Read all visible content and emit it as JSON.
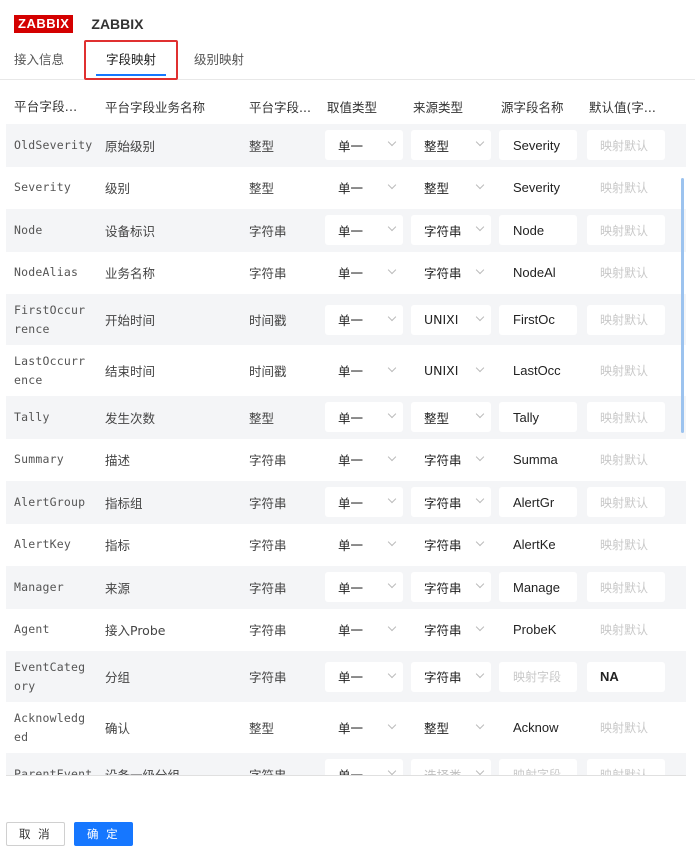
{
  "header": {
    "logo_text": "ZABBIX",
    "title": "ZABBIX"
  },
  "tabs": [
    {
      "label": "接入信息",
      "active": false
    },
    {
      "label": "字段映射",
      "active": true
    },
    {
      "label": "级别映射",
      "active": false
    }
  ],
  "table": {
    "columns": [
      "平台字段...",
      "平台字段业务名称",
      "平台字段...",
      "取值类型",
      "来源类型",
      "源字段名称",
      "默认值(字..."
    ],
    "rows": [
      {
        "field": "OldSeverity",
        "biz_name": "原始级别",
        "type": "整型",
        "value_type": "单一",
        "source_type": "整型",
        "source_field": "Severity",
        "source_field_placeholder": false,
        "default": "映射默认",
        "default_placeholder": true
      },
      {
        "field": "Severity",
        "biz_name": "级别",
        "type": "整型",
        "value_type": "单一",
        "source_type": "整型",
        "source_field": "Severity",
        "source_field_placeholder": false,
        "default": "映射默认",
        "default_placeholder": true
      },
      {
        "field": "Node",
        "biz_name": "设备标识",
        "type": "字符串",
        "value_type": "单一",
        "source_type": "字符串",
        "source_field": "Node",
        "source_field_placeholder": false,
        "default": "映射默认",
        "default_placeholder": true
      },
      {
        "field": "NodeAlias",
        "biz_name": "业务名称",
        "type": "字符串",
        "value_type": "单一",
        "source_type": "字符串",
        "source_field": "NodeAl",
        "source_field_placeholder": false,
        "default": "映射默认",
        "default_placeholder": true
      },
      {
        "field": "FirstOccurrence",
        "biz_name": "开始时间",
        "type": "时间戳",
        "value_type": "单一",
        "source_type": "UNIXI",
        "source_field": "FirstOc",
        "source_field_placeholder": false,
        "default": "映射默认",
        "default_placeholder": true
      },
      {
        "field": "LastOccurrence",
        "biz_name": "结束时间",
        "type": "时间戳",
        "value_type": "单一",
        "source_type": "UNIXI",
        "source_field": "LastOcc",
        "source_field_placeholder": false,
        "default": "映射默认",
        "default_placeholder": true
      },
      {
        "field": "Tally",
        "biz_name": "发生次数",
        "type": "整型",
        "value_type": "单一",
        "source_type": "整型",
        "source_field": "Tally",
        "source_field_placeholder": false,
        "default": "映射默认",
        "default_placeholder": true
      },
      {
        "field": "Summary",
        "biz_name": "描述",
        "type": "字符串",
        "value_type": "单一",
        "source_type": "字符串",
        "source_field": "Summa",
        "source_field_placeholder": false,
        "default": "映射默认",
        "default_placeholder": true
      },
      {
        "field": "AlertGroup",
        "biz_name": "指标组",
        "type": "字符串",
        "value_type": "单一",
        "source_type": "字符串",
        "source_field": "AlertGr",
        "source_field_placeholder": false,
        "default": "映射默认",
        "default_placeholder": true
      },
      {
        "field": "AlertKey",
        "biz_name": "指标",
        "type": "字符串",
        "value_type": "单一",
        "source_type": "字符串",
        "source_field": "AlertKe",
        "source_field_placeholder": false,
        "default": "映射默认",
        "default_placeholder": true
      },
      {
        "field": "Manager",
        "biz_name": "来源",
        "type": "字符串",
        "value_type": "单一",
        "source_type": "字符串",
        "source_field": "Manage",
        "source_field_placeholder": false,
        "default": "映射默认",
        "default_placeholder": true
      },
      {
        "field": "Agent",
        "biz_name": "接入Probe",
        "type": "字符串",
        "value_type": "单一",
        "source_type": "字符串",
        "source_field": "ProbeK",
        "source_field_placeholder": false,
        "default": "映射默认",
        "default_placeholder": true
      },
      {
        "field": "EventCategory",
        "biz_name": "分组",
        "type": "字符串",
        "value_type": "单一",
        "source_type": "字符串",
        "source_field": "映射字段",
        "source_field_placeholder": true,
        "default": "NA",
        "default_placeholder": false
      },
      {
        "field": "Acknowledged",
        "biz_name": "确认",
        "type": "整型",
        "value_type": "单一",
        "source_type": "整型",
        "source_field": "Acknow",
        "source_field_placeholder": false,
        "default": "映射默认",
        "default_placeholder": true
      },
      {
        "field": "ParentEvent",
        "biz_name": "设备一级分组",
        "type": "字符串",
        "value_type": "单一",
        "source_type": "选择类",
        "source_field": "映射字段",
        "source_field_placeholder": true,
        "default": "映射默认",
        "default_placeholder": true
      }
    ]
  },
  "footer": {
    "cancel_label": "取 消",
    "ok_label": "确 定"
  }
}
